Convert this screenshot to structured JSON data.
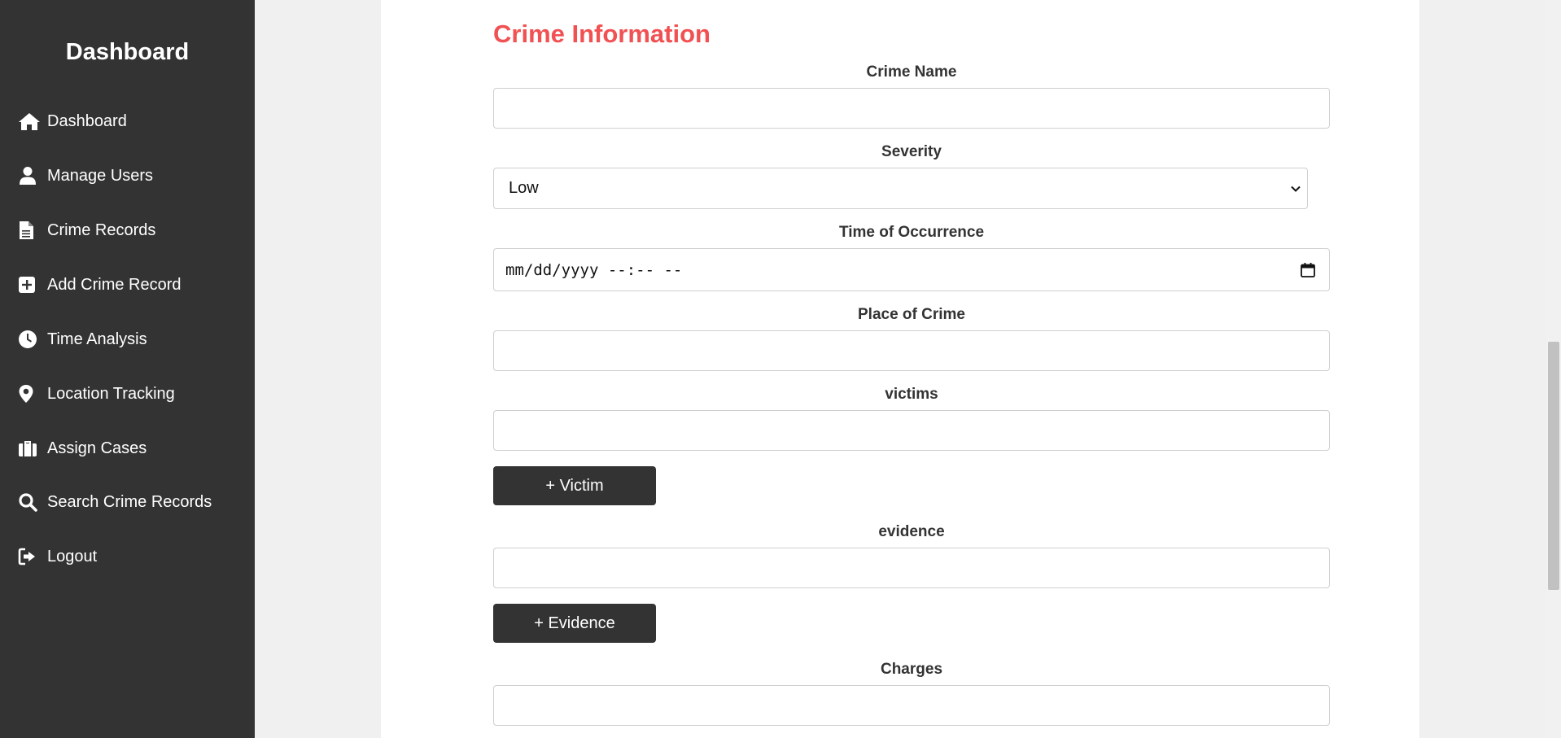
{
  "sidebar": {
    "title": "Dashboard",
    "items": [
      {
        "label": "Dashboard",
        "icon": "home-icon"
      },
      {
        "label": "Manage Users",
        "icon": "user-icon"
      },
      {
        "label": "Crime Records",
        "icon": "file-icon"
      },
      {
        "label": "Add Crime Record",
        "icon": "plus-square-icon"
      },
      {
        "label": "Time Analysis",
        "icon": "clock-icon"
      },
      {
        "label": "Location Tracking",
        "icon": "map-pin-icon"
      },
      {
        "label": "Assign Cases",
        "icon": "briefcase-icon"
      },
      {
        "label": "Search Crime Records",
        "icon": "search-icon"
      },
      {
        "label": "Logout",
        "icon": "logout-icon"
      }
    ]
  },
  "form": {
    "section_title": "Crime Information",
    "crime_name": {
      "label": "Crime Name",
      "value": ""
    },
    "severity": {
      "label": "Severity",
      "value": "Low"
    },
    "time_of_occurrence": {
      "label": "Time of Occurrence",
      "value": "mm/dd/yyyy --:-- --"
    },
    "place_of_crime": {
      "label": "Place of Crime",
      "value": ""
    },
    "victims": {
      "label": "victims",
      "value": "",
      "add_button": "+ Victim"
    },
    "evidence": {
      "label": "evidence",
      "value": "",
      "add_button": "+ Evidence"
    },
    "charges": {
      "label": "Charges",
      "value": ""
    }
  },
  "colors": {
    "sidebar_bg": "#333333",
    "accent_title": "#f15152",
    "button_bg": "#333333"
  }
}
